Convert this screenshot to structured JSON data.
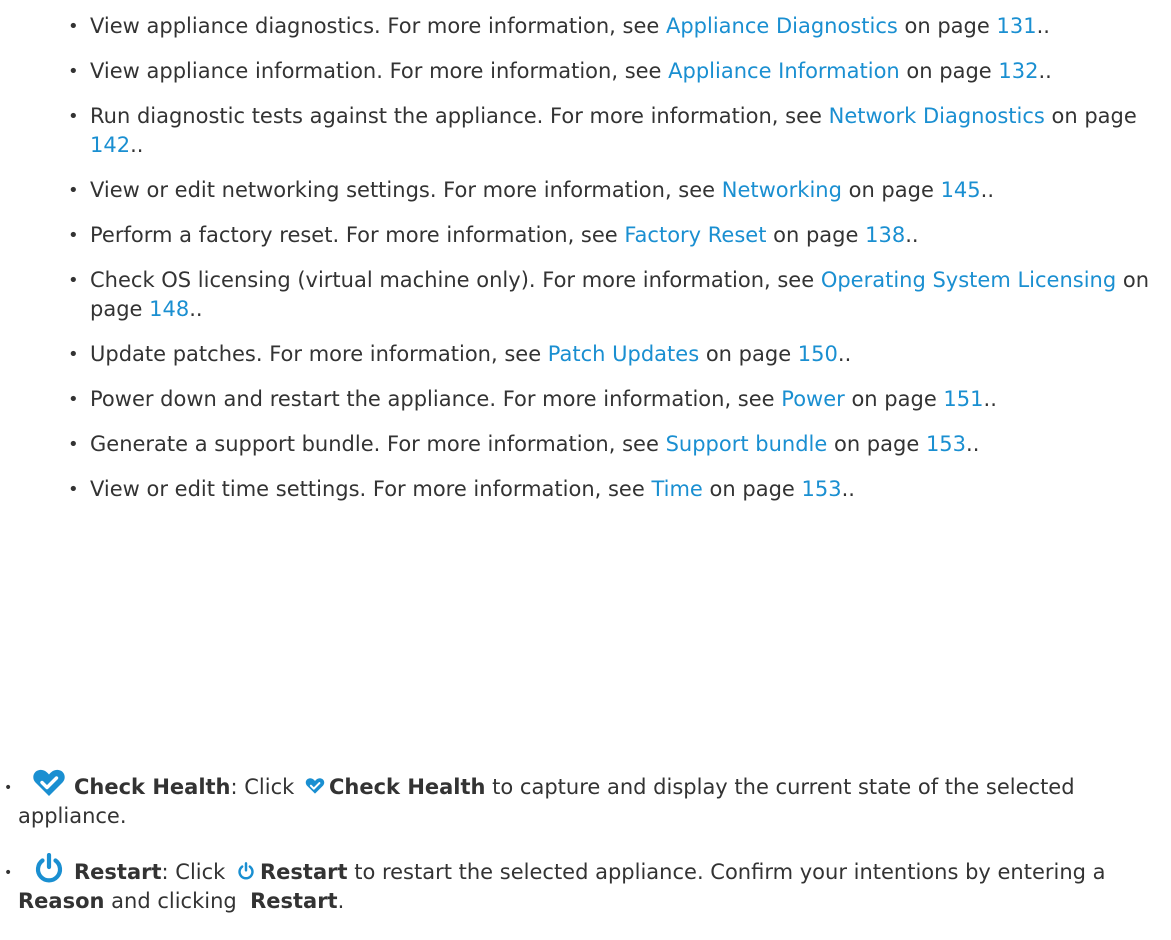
{
  "sub_items": [
    {
      "text": "View appliance diagnostics. For more information, see ",
      "link": "Appliance Diagnostics",
      "mid": " on page ",
      "page": "131",
      "end": ".."
    },
    {
      "text": "View appliance information. For more information, see ",
      "link": "Appliance Information",
      "mid": " on page ",
      "page": "132",
      "end": ".."
    },
    {
      "text": "Run diagnostic tests against the appliance. For more information, see ",
      "link": "Network Diagnostics",
      "mid": " on page ",
      "page": "142",
      "end": ".."
    },
    {
      "text": "View or edit networking settings. For more information, see ",
      "link": "Networking",
      "mid": " on page ",
      "page": "145",
      "end": ".."
    },
    {
      "text": "Perform a factory reset. For more information, see ",
      "link": "Factory Reset",
      "mid": " on page ",
      "page": "138",
      "end": ".."
    },
    {
      "text": "Check OS licensing (virtual machine only). For more information, see ",
      "link": "Operating System Licensing",
      "mid": " on page ",
      "page": "148",
      "end": ".."
    },
    {
      "text": "Update patches. For more information, see ",
      "link": "Patch Updates",
      "mid": " on page ",
      "page": "150",
      "end": ".."
    },
    {
      "text": "Power down and restart the appliance. For more information, see ",
      "link": "Power",
      "mid": " on page ",
      "page": "151",
      "end": ".."
    },
    {
      "text": "Generate a support bundle. For more information, see ",
      "link": "Support bundle",
      "mid": " on page ",
      "page": "153",
      "end": ".."
    },
    {
      "text": "View or edit time settings. For more information, see ",
      "link": "Time",
      "mid": " on page ",
      "page": "153",
      "end": ".."
    }
  ],
  "check_health": {
    "bullet": "•",
    "icon": "heart-icon",
    "label": "Check Health",
    "colon": ": Click ",
    "label2": "Check Health",
    "rest": " to capture and display the current state of the selected appliance."
  },
  "restart": {
    "bullet": "•",
    "icon": "power-icon",
    "label": "Restart",
    "colon": ": Click ",
    "label2": "Restart",
    "rest": " to restart the selected appliance. Confirm your intentions by entering a ",
    "reason": "Reason",
    "and": " and clicking  ",
    "label3": "Restart",
    "end": "."
  },
  "colors": {
    "text": "#333333",
    "link": "#1a8fd1",
    "icon": "#1a8fd1"
  }
}
